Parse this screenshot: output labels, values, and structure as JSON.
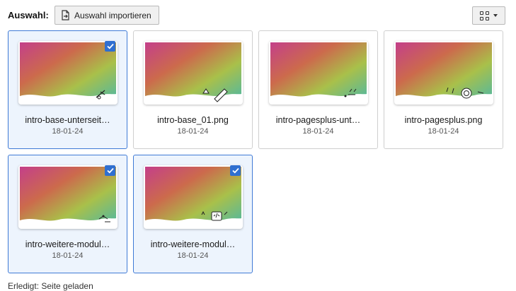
{
  "selection": {
    "label": "Auswahl:",
    "import_button": "Auswahl importieren"
  },
  "view_toggle": {
    "icon": "grid-view-icon"
  },
  "files": [
    {
      "name": "intro-base-unterseit…",
      "date": "18-01-24",
      "selected": true
    },
    {
      "name": "intro-base_01.png",
      "date": "18-01-24",
      "selected": false
    },
    {
      "name": "intro-pagesplus-unt…",
      "date": "18-01-24",
      "selected": false
    },
    {
      "name": "intro-pagesplus.png",
      "date": "18-01-24",
      "selected": false
    },
    {
      "name": "intro-weitere-modul…",
      "date": "18-01-24",
      "selected": true
    },
    {
      "name": "intro-weitere-modul…",
      "date": "18-01-24",
      "selected": true
    }
  ],
  "footer_text": "Erledigt: Seite geladen",
  "colors": {
    "selected_border": "#3f7ad6",
    "selected_bg": "#edf4fd",
    "checkbox": "#2f6fd0"
  }
}
